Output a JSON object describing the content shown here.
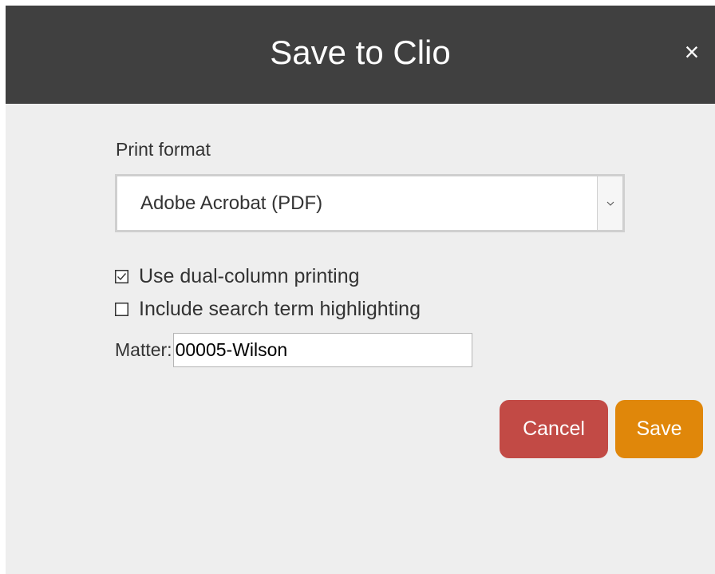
{
  "dialog": {
    "title": "Save to Clio",
    "close_glyph": "×"
  },
  "print_format": {
    "label": "Print format",
    "selected": "Adobe Acrobat (PDF)"
  },
  "options": [
    {
      "label": "Use dual-column printing",
      "checked": true
    },
    {
      "label": "Include search term highlighting",
      "checked": false
    }
  ],
  "matter": {
    "label": "Matter:",
    "value": "00005-Wilson"
  },
  "buttons": {
    "cancel_label": "Cancel",
    "save_label": "Save"
  },
  "colors": {
    "titlebar": "#404040",
    "background": "#eeeeee",
    "cancel": "#c24a45",
    "save": "#e0870a"
  },
  "icons": {
    "close": "close-icon",
    "dropdown": "chevron-down-icon",
    "checked": "checkbox-checked-icon",
    "unchecked": "checkbox-unchecked-icon"
  }
}
